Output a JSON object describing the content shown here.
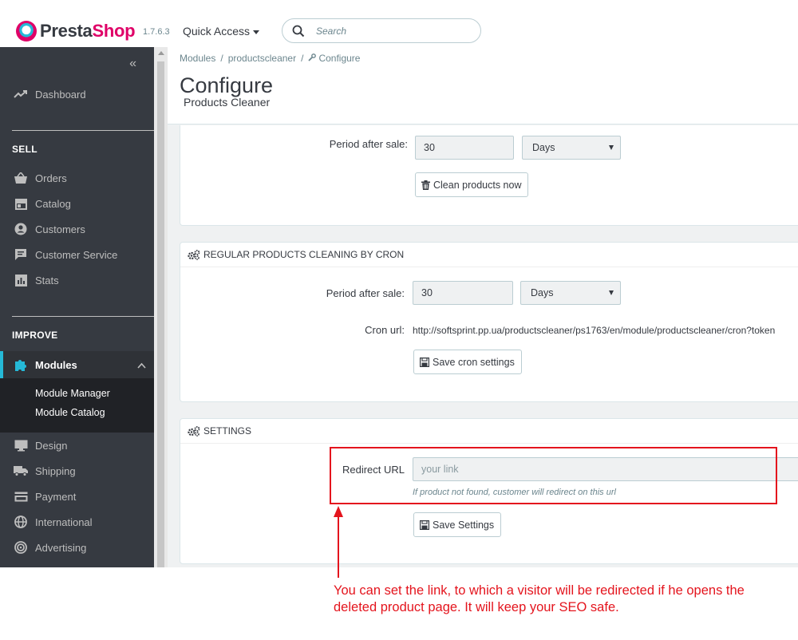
{
  "header": {
    "logo_presta": "Presta",
    "logo_shop": "Shop",
    "version": "1.7.6.3",
    "quick_access": "Quick Access",
    "search_placeholder": "Search"
  },
  "sidebar": {
    "dashboard": "Dashboard",
    "sell_title": "SELL",
    "sell_items": [
      "Orders",
      "Catalog",
      "Customers",
      "Customer Service",
      "Stats"
    ],
    "improve_title": "IMPROVE",
    "modules": "Modules",
    "modules_sub": [
      "Module Manager",
      "Module Catalog"
    ],
    "improve_items": [
      "Design",
      "Shipping",
      "Payment",
      "International",
      "Advertising"
    ]
  },
  "breadcrumb": {
    "items": [
      "Modules",
      "productscleaner",
      "Configure"
    ]
  },
  "page": {
    "title": "Configure",
    "subtitle": "Products Cleaner"
  },
  "panel_manual": {
    "period_label": "Period after sale:",
    "period_value": "30",
    "unit_value": "Days",
    "button": "Clean products now"
  },
  "panel_cron": {
    "heading": "REGULAR PRODUCTS CLEANING BY CRON",
    "period_label": "Period after sale:",
    "period_value": "30",
    "unit_value": "Days",
    "cron_label": "Cron url:",
    "cron_url": "http://softsprint.pp.ua/productscleaner/ps1763/en/module/productscleaner/cron?token",
    "button": "Save cron settings"
  },
  "panel_settings": {
    "heading": "SETTINGS",
    "redirect_label": "Redirect URL",
    "redirect_placeholder": "your link",
    "help_text": "If product not found, customer will redirect on this url",
    "button": "Save Settings"
  },
  "annotation": {
    "text": "You can set the link, to which a visitor will be redirected if he opens the deleted product page. It will keep your SEO safe."
  },
  "colors": {
    "accent": "#25b9d7",
    "brand_pink": "#df0067",
    "annotation_red": "#e4141d",
    "sidebar_bg": "#363a41"
  }
}
